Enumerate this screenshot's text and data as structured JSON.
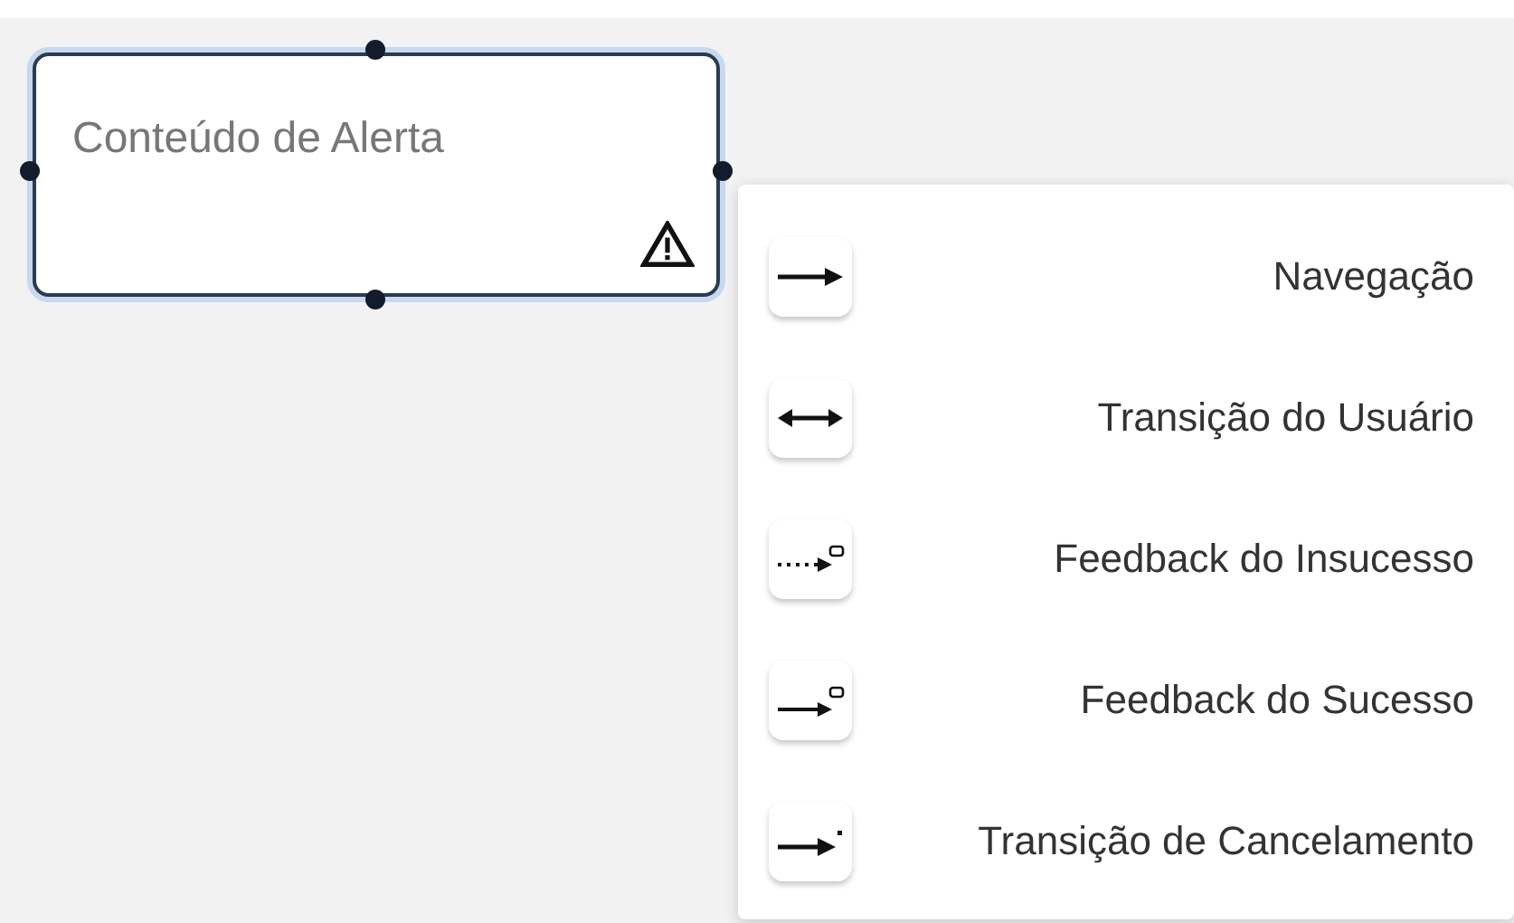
{
  "node": {
    "title": "Conteúdo de Alerta",
    "selected": true
  },
  "menu": {
    "items": [
      {
        "kind": "arrow",
        "label": "Navegação"
      },
      {
        "kind": "double-arrow",
        "label": "Transição do Usuário"
      },
      {
        "kind": "dotted-feedback",
        "label": "Feedback do Insucesso"
      },
      {
        "kind": "feedback",
        "label": "Feedback do Sucesso"
      },
      {
        "kind": "cancel",
        "label": "Transição de Cancelamento"
      }
    ]
  }
}
